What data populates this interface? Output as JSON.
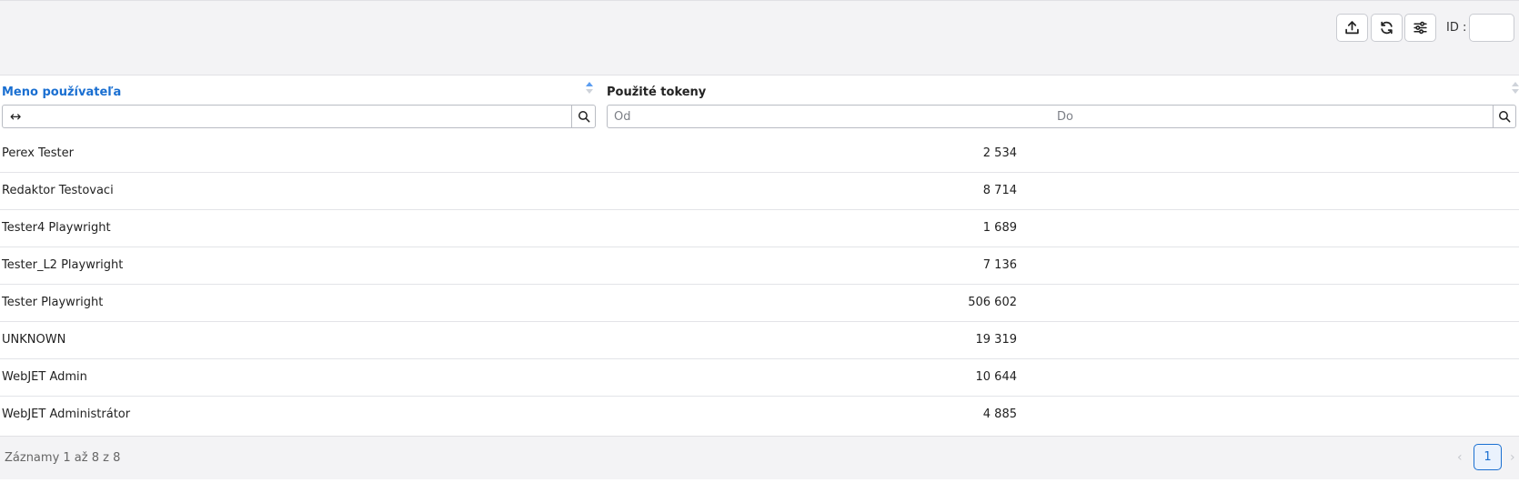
{
  "toolbar": {
    "buttons": [
      {
        "name": "export-button",
        "icon": "upload-icon"
      },
      {
        "name": "reload-button",
        "icon": "refresh-icon"
      },
      {
        "name": "settings-button",
        "icon": "sliders-icon"
      }
    ],
    "id_label": "ID :",
    "id_value": ""
  },
  "table": {
    "columns": [
      {
        "label": "Meno používateľa",
        "sorted": "asc"
      },
      {
        "label": "Použité tokeny"
      }
    ],
    "filters": {
      "user_value": "",
      "from_placeholder": "Od",
      "to_placeholder": "Do",
      "width_toggle_glyph": "↔"
    },
    "rows": [
      {
        "name": "Perex Tester",
        "tokens": "2 534"
      },
      {
        "name": "Redaktor Testovaci",
        "tokens": "8 714"
      },
      {
        "name": "Tester4 Playwright",
        "tokens": "1 689"
      },
      {
        "name": "Tester_L2 Playwright",
        "tokens": "7 136"
      },
      {
        "name": "Tester Playwright",
        "tokens": "506 602"
      },
      {
        "name": "UNKNOWN",
        "tokens": "19 319"
      },
      {
        "name": "WebJET Admin",
        "tokens": "10 644"
      },
      {
        "name": "WebJET Administrátor",
        "tokens": "4 885"
      }
    ]
  },
  "footer": {
    "info": "Záznamy 1 až 8 z 8",
    "current_page": "1",
    "prev_glyph": "‹",
    "next_glyph": "›"
  },
  "colors": {
    "accent": "#1a6fd1",
    "toolbar_bg": "#f3f3f5",
    "border": "#c9cbd1"
  }
}
